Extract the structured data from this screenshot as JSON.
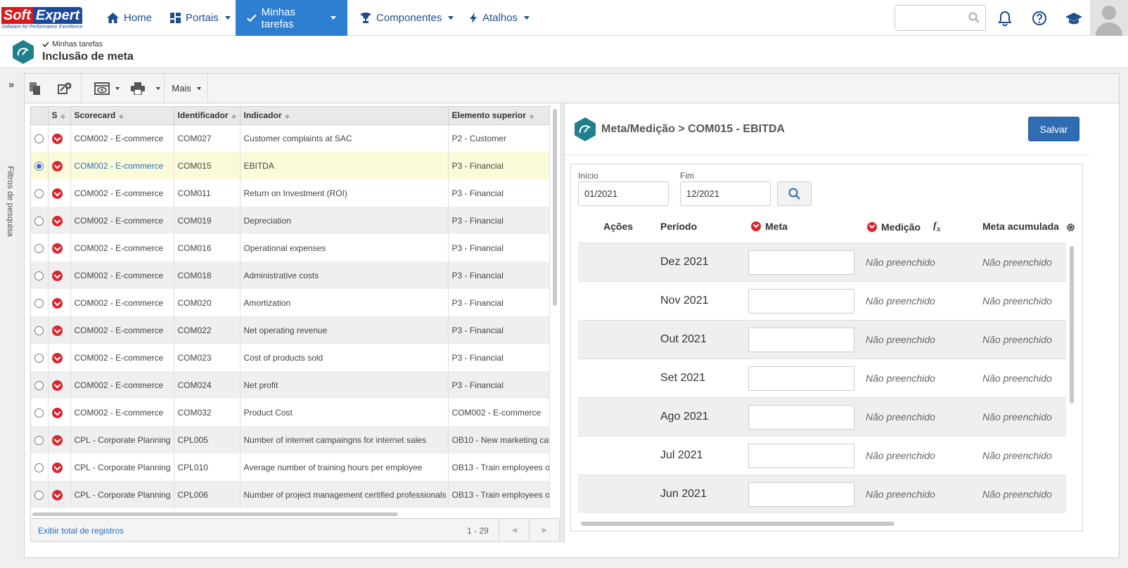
{
  "brand": {
    "soft": "Soft",
    "expert": "Expert",
    "tagline": "Software for Performance Excellence"
  },
  "nav": {
    "home": "Home",
    "portais": "Portais",
    "minhas_tarefas": "Minhas tarefas",
    "componentes": "Componentes",
    "atalhos": "Atalhos",
    "search_placeholder": ""
  },
  "header": {
    "breadcrumb": "Minhas tarefas",
    "title": "Inclusão de meta"
  },
  "sidebar": {
    "filters_label": "Filtros de pesquisa"
  },
  "toolbar": {
    "mais": "Mais"
  },
  "grid": {
    "columns": [
      "S",
      "Scorecard",
      "Identificador",
      "Indicador",
      "Elemento superior"
    ],
    "rows": [
      {
        "scorecard": "COM002 - E-commerce",
        "id": "COM027",
        "indicador": "Customer complaints at SAC",
        "elemento": "P2 - Customer",
        "selected": false
      },
      {
        "scorecard": "COM002 - E-commerce",
        "id": "COM015",
        "indicador": "EBITDA",
        "elemento": "P3 - Financial",
        "selected": true
      },
      {
        "scorecard": "COM002 - E-commerce",
        "id": "COM011",
        "indicador": "Return on Investment (ROI)",
        "elemento": "P3 - Financial",
        "selected": false
      },
      {
        "scorecard": "COM002 - E-commerce",
        "id": "COM019",
        "indicador": "Depreciation",
        "elemento": "P3 - Financial",
        "selected": false
      },
      {
        "scorecard": "COM002 - E-commerce",
        "id": "COM016",
        "indicador": "Operational expenses",
        "elemento": "P3 - Financial",
        "selected": false
      },
      {
        "scorecard": "COM002 - E-commerce",
        "id": "COM018",
        "indicador": "Administrative costs",
        "elemento": "P3 - Financial",
        "selected": false
      },
      {
        "scorecard": "COM002 - E-commerce",
        "id": "COM020",
        "indicador": "Amortization",
        "elemento": "P3 - Financial",
        "selected": false
      },
      {
        "scorecard": "COM002 - E-commerce",
        "id": "COM022",
        "indicador": "Net operating revenue",
        "elemento": "P3 - Financial",
        "selected": false
      },
      {
        "scorecard": "COM002 - E-commerce",
        "id": "COM023",
        "indicador": "Cost of products sold",
        "elemento": "P3 - Financial",
        "selected": false
      },
      {
        "scorecard": "COM002 - E-commerce",
        "id": "COM024",
        "indicador": "Net profit",
        "elemento": "P3 - Financial",
        "selected": false
      },
      {
        "scorecard": "COM002 - E-commerce",
        "id": "COM032",
        "indicador": "Product Cost",
        "elemento": "COM002 - E-commerce",
        "selected": false
      },
      {
        "scorecard": "CPL - Corporate Planning",
        "id": "CPL005",
        "indicador": "Number of internet campaingns for internet sales",
        "elemento": "OB10 - New marketing cam",
        "selected": false
      },
      {
        "scorecard": "CPL - Corporate Planning",
        "id": "CPL010",
        "indicador": "Average number of training hours per employee",
        "elemento": "OB13 - Train employees or",
        "selected": false
      },
      {
        "scorecard": "CPL - Corporate Planning",
        "id": "CPL006",
        "indicador": "Number of project management certified professionals",
        "elemento": "OB13 - Train employees or",
        "selected": false
      }
    ],
    "footer_link": "Exibir total de registros",
    "pagination": "1 - 29"
  },
  "right": {
    "title": "Meta/Medição > COM015 - EBITDA",
    "save": "Salvar",
    "inicio_label": "Início",
    "inicio_value": "01/2021",
    "fim_label": "Fim",
    "fim_value": "12/2021",
    "headers": {
      "acoes": "Ações",
      "periodo": "Período",
      "meta": "Meta",
      "medicao": "Medição",
      "acumulada": "Meta acumulada"
    },
    "periods": [
      "Dez 2021",
      "Nov 2021",
      "Out 2021",
      "Set 2021",
      "Ago 2021",
      "Jul 2021",
      "Jun 2021"
    ],
    "empty_text": "Não preenchido"
  },
  "colors": {
    "accent": "#2c7fd1",
    "primary_button": "#2f6cb3",
    "status_red": "#d9262e",
    "brand_red": "#d71920",
    "brand_blue": "#1a4a9c",
    "teal": "#1f7f8c"
  }
}
